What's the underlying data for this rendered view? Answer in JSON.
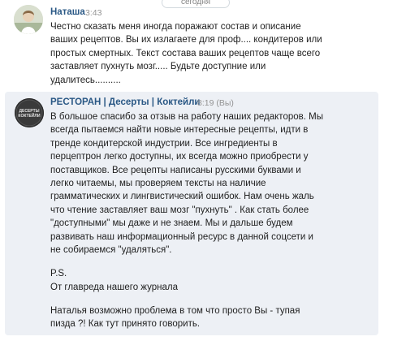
{
  "date_separator": "сегодня",
  "messages": [
    {
      "sender": "Наташа",
      "time": "3:43",
      "lines": [
        "Честно сказать меня иногда поражают состав и описание",
        "ваших рецептов. Вы их излагаете для проф.... кондитеров или",
        "простых смертных. Текст состава ваших рецептов чаще всего",
        "заставляет пухнуть мозг..... Будьте доступние или",
        "удалитесь.........."
      ]
    },
    {
      "sender": "РЕСТОРАН | Десерты | Коктейли",
      "time": "8:19 (Вы)",
      "avatar_text": [
        "ДЕСЕРТЫ",
        "КОКТЕЙЛИ"
      ],
      "lines": [
        "В большое спасибо за отзыв на работу наших редакторов. Мы",
        "всегда пытаемся найти новые интересные рецепты, идти в",
        "тренде кондитерской индустрии. Все ингредиенты в",
        "перцептрон легко доступны, их всегда можно приобрести у",
        "поставщиков. Все рецепты написаны русскими буквами и",
        "легко читаемы, мы проверяем тексты на наличие",
        "грамматических и лингвистический ошибок. Нам очень жаль",
        "что чтение заставляет ваш мозг \"пухнуть\" . Как стать более",
        "\"доступными\" мы даже и не знаем. Мы и дальше будем",
        "развивать наш информационный ресурс в данной соцсети и",
        "не собираемся \"удаляться\"."
      ],
      "ps_lines": [
        "P.S.",
        "От главреда нашего журнала"
      ],
      "final_lines": [
        "Наталья возможно проблема в том что просто Вы - тупая",
        "пизда ?! Как тут принято говорить."
      ]
    }
  ]
}
